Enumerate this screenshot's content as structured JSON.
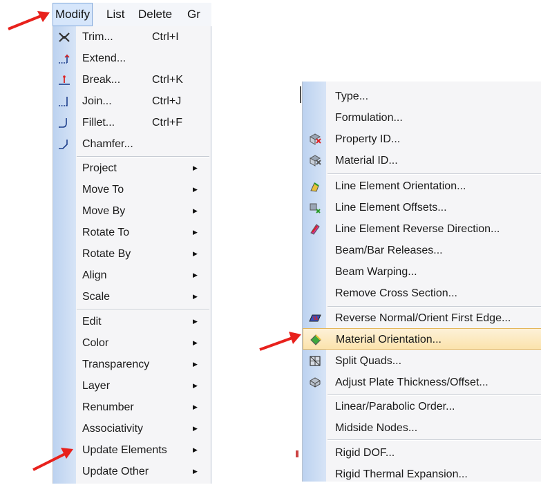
{
  "menubar": {
    "items": [
      {
        "label": "Modify",
        "active": true
      },
      {
        "label": "List"
      },
      {
        "label": "Delete"
      },
      {
        "label": "Gr"
      }
    ]
  },
  "left_menu": {
    "items": [
      {
        "label": "Trim...",
        "shortcut": "Ctrl+I",
        "icon": "trim-icon"
      },
      {
        "label": "Extend...",
        "icon": "extend-icon"
      },
      {
        "label": "Break...",
        "shortcut": "Ctrl+K",
        "icon": "break-icon"
      },
      {
        "label": "Join...",
        "shortcut": "Ctrl+J",
        "icon": "join-icon"
      },
      {
        "label": "Fillet...",
        "shortcut": "Ctrl+F",
        "icon": "fillet-icon"
      },
      {
        "label": "Chamfer...",
        "icon": "chamfer-icon"
      },
      {
        "label": "Project",
        "submenu": true
      },
      {
        "label": "Move To",
        "submenu": true
      },
      {
        "label": "Move By",
        "submenu": true
      },
      {
        "label": "Rotate To",
        "submenu": true
      },
      {
        "label": "Rotate By",
        "submenu": true
      },
      {
        "label": "Align",
        "submenu": true
      },
      {
        "label": "Scale",
        "submenu": true
      },
      {
        "label": "Edit",
        "submenu": true
      },
      {
        "label": "Color",
        "submenu": true
      },
      {
        "label": "Transparency",
        "submenu": true
      },
      {
        "label": "Layer",
        "submenu": true
      },
      {
        "label": "Renumber",
        "submenu": true
      },
      {
        "label": "Associativity",
        "submenu": true
      },
      {
        "label": "Update Elements",
        "submenu": true
      },
      {
        "label": "Update Other",
        "submenu": true
      }
    ]
  },
  "right_menu": {
    "items": [
      {
        "label": "Type..."
      },
      {
        "label": "Formulation..."
      },
      {
        "label": "Property ID...",
        "icon": "property-id-icon"
      },
      {
        "label": "Material ID...",
        "icon": "material-id-icon"
      },
      {
        "label": "Line Element Orientation...",
        "icon": "line-orientation-icon"
      },
      {
        "label": "Line Element Offsets...",
        "icon": "line-offsets-icon"
      },
      {
        "label": "Line Element Reverse Direction...",
        "icon": "reverse-direction-icon"
      },
      {
        "label": "Beam/Bar Releases..."
      },
      {
        "label": "Beam Warping..."
      },
      {
        "label": "Remove Cross Section..."
      },
      {
        "label": "Reverse Normal/Orient First Edge...",
        "icon": "reverse-normal-icon"
      },
      {
        "label": "Material Orientation...",
        "icon": "material-orientation-icon",
        "highlighted": true
      },
      {
        "label": "Split Quads...",
        "icon": "split-quads-icon"
      },
      {
        "label": "Adjust Plate Thickness/Offset...",
        "icon": "plate-thickness-icon"
      },
      {
        "label": "Linear/Parabolic Order..."
      },
      {
        "label": "Midside Nodes..."
      },
      {
        "label": "Rigid DOF..."
      },
      {
        "label": "Rigid Thermal Expansion..."
      }
    ]
  },
  "colors": {
    "gutter": "#c8daf3",
    "highlight": "#fbe3ac",
    "annotation_arrow": "#e8211c"
  }
}
